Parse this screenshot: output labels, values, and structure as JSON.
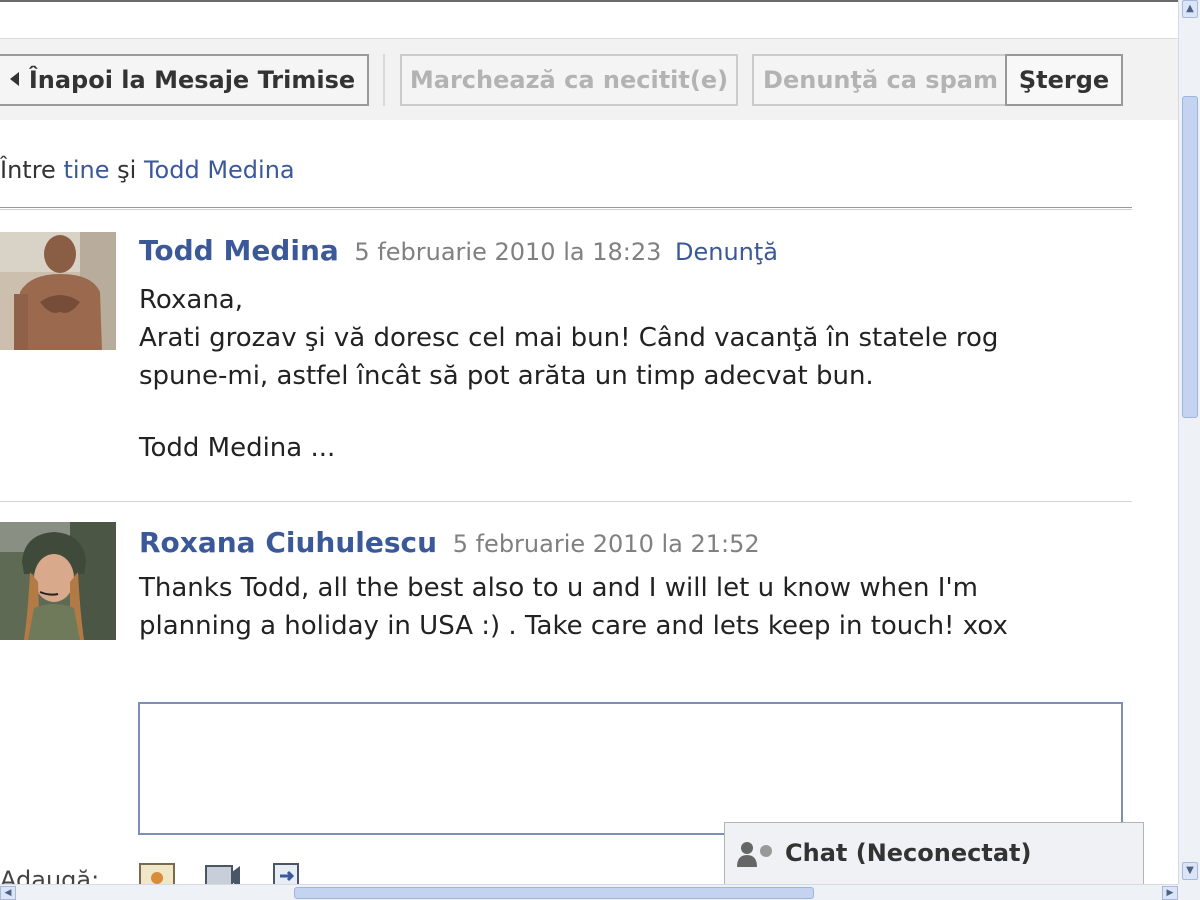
{
  "toolbar": {
    "back_label": "Înapoi la Mesaje Trimise",
    "mark_unread_label": "Marchează ca necitit(e)",
    "report_spam_label": "Denunţă ca spam",
    "delete_label": "Şterge"
  },
  "thread": {
    "between_prefix": "Între",
    "between_you": "tine",
    "between_and": "şi",
    "between_other": "Todd Medina"
  },
  "messages": [
    {
      "sender": "Todd Medina",
      "timestamp": "5 februarie 2010 la 18:23",
      "report_label": "Denunţă",
      "lines": [
        "Roxana,",
        "Arati grozav şi vă doresc cel mai bun! Când vacanţă în statele rog",
        "spune-mi, astfel încât să pot arăta un timp adecvat bun.",
        "Todd Medina ..."
      ]
    },
    {
      "sender": "Roxana Ciuhulescu",
      "timestamp": "5 februarie 2010 la 21:52",
      "lines": [
        "Thanks Todd, all the best also to u and I will let u know when I'm",
        "planning a holiday in USA :) . Take care and lets keep in touch! xox"
      ]
    }
  ],
  "reply": {
    "attach_label": "Adaugă:"
  },
  "chat": {
    "label": "Chat (Neconectat)"
  },
  "colors": {
    "link": "#3b5998",
    "timestamp": "#808080",
    "toolbar_bg": "#f2f2f2"
  }
}
